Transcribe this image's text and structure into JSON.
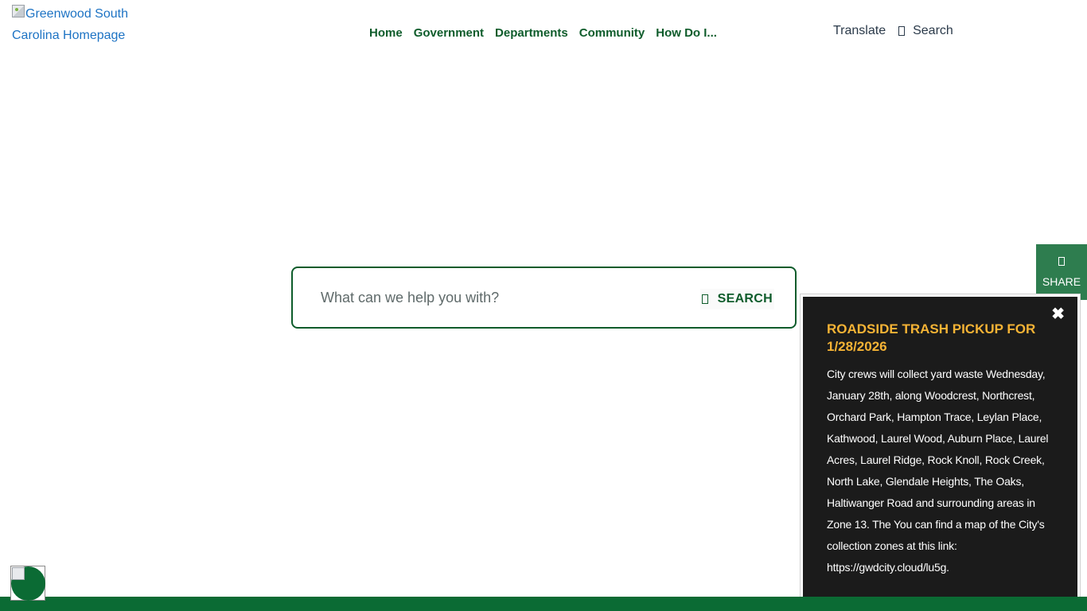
{
  "header": {
    "logo_alt": "Greenwood South Carolina Homepage",
    "nav": [
      {
        "label": "Home"
      },
      {
        "label": "Government"
      },
      {
        "label": "Departments"
      },
      {
        "label": "Community"
      },
      {
        "label": "How Do I..."
      }
    ],
    "translate_label": "Translate",
    "search_label": "Search"
  },
  "search": {
    "placeholder": "What can we help you with?",
    "button_label": "SEARCH"
  },
  "share": {
    "label": "SHARE"
  },
  "alert": {
    "close_glyph": "✖",
    "title": "ROADSIDE TRASH PICKUP FOR 1/28/2026",
    "body": "City crews will collect yard waste Wednesday, January 28th, along Woodcrest, Northcrest, Orchard Park, Hampton Trace, Leylan Place, Kathwood, Laurel Wood, Auburn Place, Laurel Acres, Laurel Ridge, Rock Knoll, Rock Creek, North Lake, Glendale Heights, The Oaks, Haltiwanger Road and surrounding areas in Zone 13. The You can find a map of the City's collection zones at this link: https://gwdcity.cloud/lu5g."
  },
  "colors": {
    "brand_green": "#0e5c2b",
    "footer_green": "#0b6b34",
    "alert_title": "#f5b335",
    "link_blue": "#1d73c4"
  }
}
